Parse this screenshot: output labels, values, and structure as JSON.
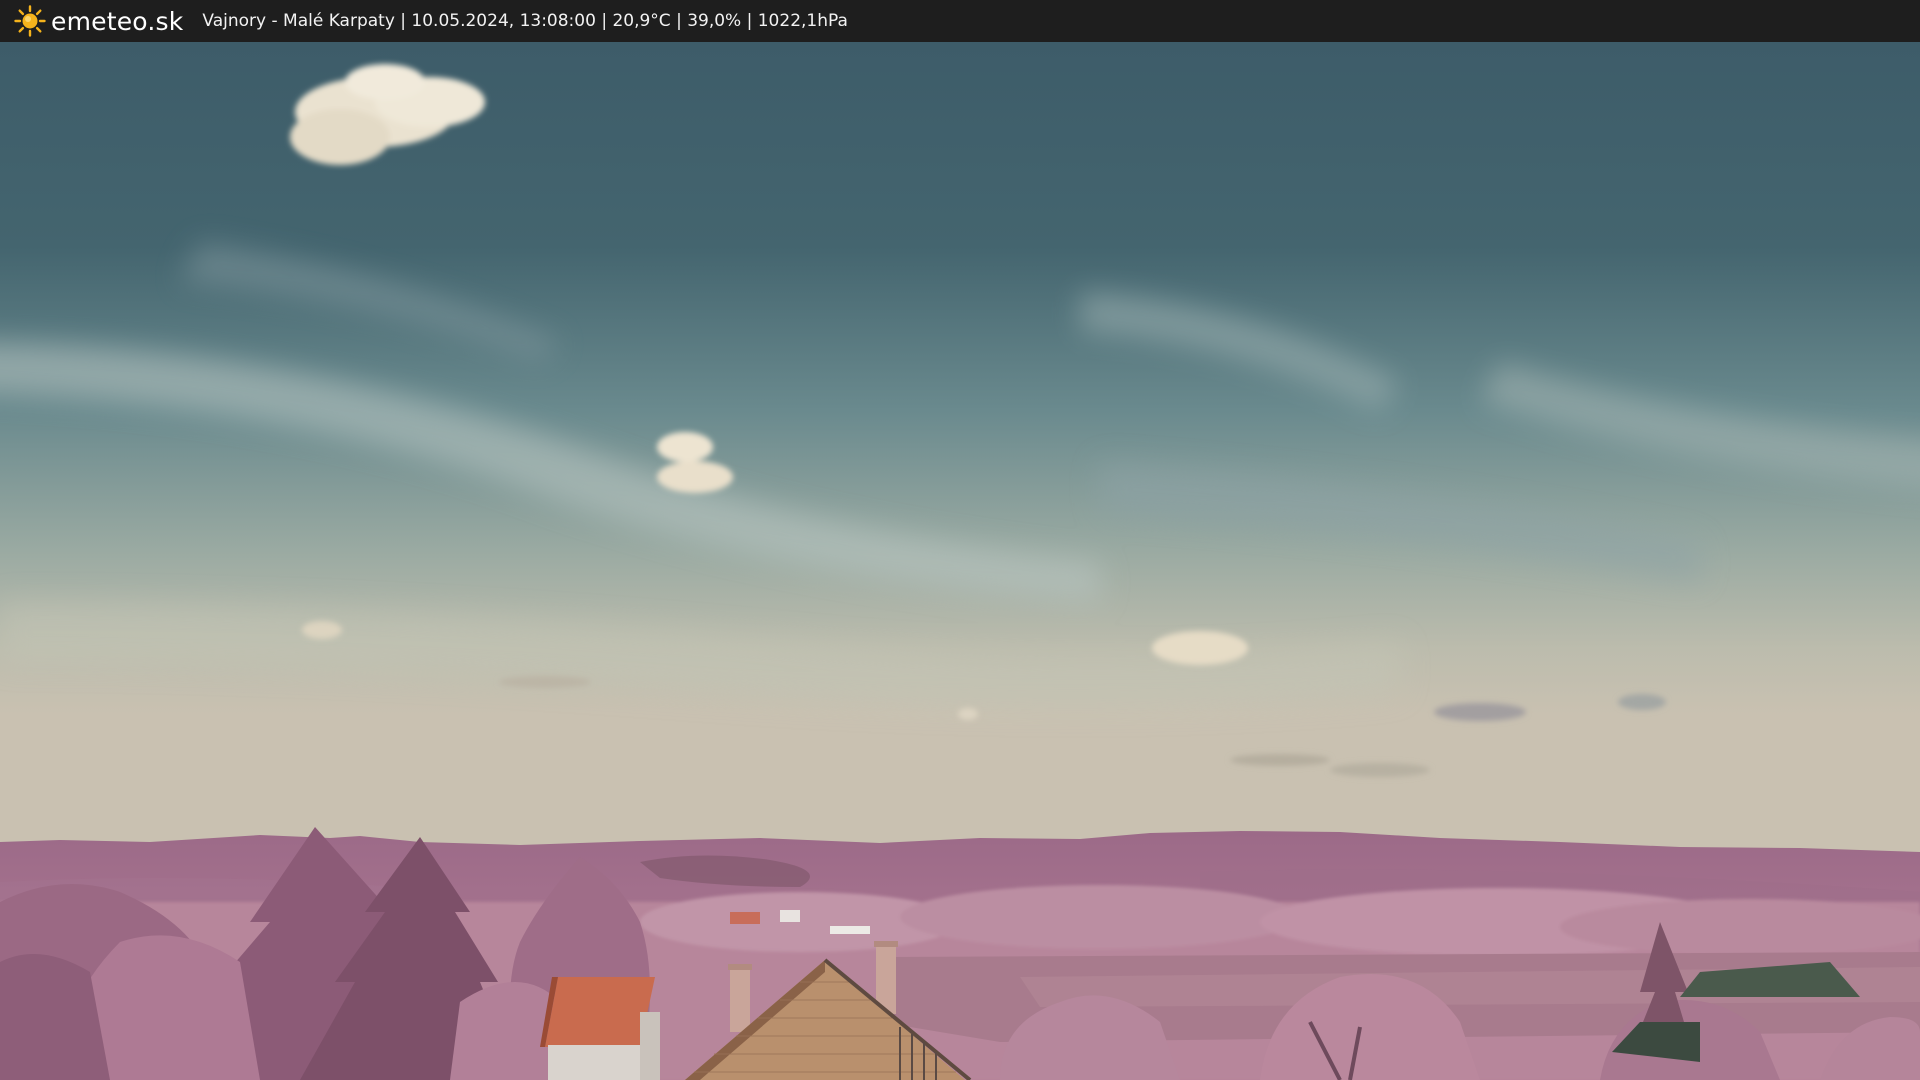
{
  "header": {
    "brand": "emeteo.sk",
    "brand_icon": "sun-icon",
    "status": "Vajnory - Malé Karpaty | 10.05.2024, 13:08:00 | 20,9°C | 39,0% | 1022,1hPa"
  },
  "colors": {
    "bar_background": "#1e1e1e",
    "sun": "#f5b31c",
    "sky_top": "#3f5f6c",
    "sky_horizon": "#c6bfae",
    "hills": "#a46e8c",
    "foliage": "#b88198",
    "roof_tile": "#c96b4e"
  }
}
